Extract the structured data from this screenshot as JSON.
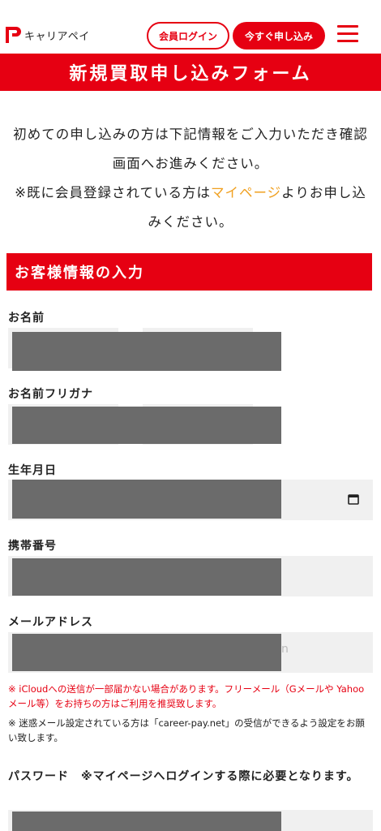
{
  "header": {
    "logo_text": "キャリアペイ",
    "login_label": "会員ログイン",
    "apply_label": "今すぐ申し込み"
  },
  "page_title": "新規買取申し込みフォーム",
  "intro": {
    "line1": "初めての申し込みの方は下記情報をご入力いただき確認画面へお進みください。",
    "line2_prefix": "※既に会員登録されている方は",
    "line2_link": "マイページ",
    "line2_suffix": "よりお申し込みください。"
  },
  "section_title": "お客様情報の入力",
  "fields": {
    "name_label": "お名前",
    "kana_label": "お名前フリガナ",
    "birth_label": "生年月日",
    "phone_label": "携帯番号",
    "email_label": "メールアドレス",
    "email_ghost": "n",
    "password_label": "パスワード　※マイページへログインする際に必要となります。"
  },
  "notes": {
    "red": "※ iCloudへの送信が一部届かない場合があります。フリーメール（Gメールや Yahooメール等）をお持ちの方はご利用を推奨致します。",
    "black": "※ 迷惑メール設定されている方は「career-pay.net」の受信ができるよう設定をお願い致します。"
  },
  "colors": {
    "brand_red": "#e60012",
    "link_orange": "#f0a020",
    "masked_gray": "#6b6b6b",
    "field_bg": "#f0f0f0"
  },
  "icons": [
    "career-pay-logo-icon",
    "hamburger-menu-icon",
    "calendar-icon"
  ]
}
